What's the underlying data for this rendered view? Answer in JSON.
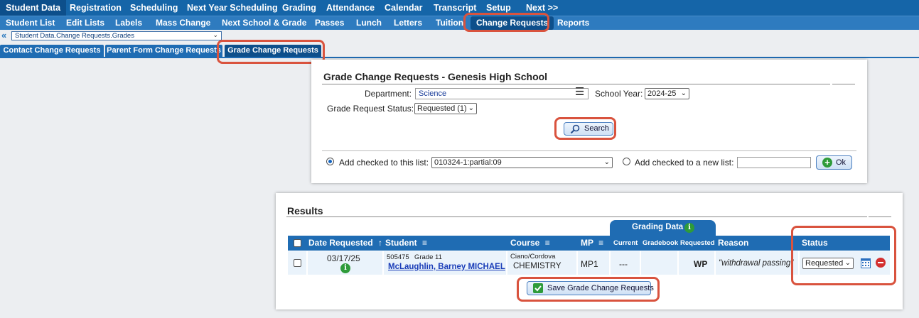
{
  "nav_main": [
    "Student Data",
    "Registration",
    "Scheduling",
    "Next Year Scheduling",
    "Grading",
    "Attendance",
    "Calendar",
    "Transcript",
    "Setup",
    "Next >>"
  ],
  "nav_sub": [
    "Student List",
    "Edit Lists",
    "Labels",
    "Mass Change",
    "Next School & Grade",
    "Passes",
    "Lunch",
    "Letters",
    "Tuition",
    "Change Requests",
    "Reports"
  ],
  "breadcrumb": "Student Data.Change Requests.Grades",
  "tabs": [
    "Contact Change Requests",
    "Parent Form Change Requests",
    "Grade Change Requests"
  ],
  "search_panel": {
    "title": "Grade Change Requests - Genesis High School",
    "department_label": "Department:",
    "department_value": "Science",
    "school_year_label": "School Year:",
    "school_year_value": "2024-25",
    "status_label": "Grade Request Status:",
    "status_value": "Requested (1)",
    "search_button": "Search",
    "add_checked_label": "Add checked to this list:",
    "list_value": "010324-1:partial:09",
    "add_new_label": "Add checked to a new list:",
    "new_list_value": "",
    "ok_button": "Ok"
  },
  "results": {
    "title": "Results",
    "grading_data_label": "Grading Data",
    "columns": {
      "date": "Date Requested",
      "student": "Student",
      "course": "Course",
      "mp": "MP",
      "current": "Current",
      "gradebook": "Gradebook",
      "requested": "Requested",
      "reason": "Reason",
      "status": "Status"
    },
    "row": {
      "date": "03/17/25",
      "student_id": "505475",
      "grade": "Grade 11",
      "student_name": "McLaughlin, Barney MICHAEL",
      "teacher": "Ciano/Cordova",
      "course": "CHEMISTRY",
      "mp": "MP1",
      "current": "---",
      "gradebook": "",
      "requested": "WP",
      "reason": "\"withdrawal passing\"",
      "status": "Requested"
    },
    "save_button": "Save Grade Change Requests"
  },
  "icons": {
    "sort_up": "↑",
    "menu": "≡",
    "info": "i",
    "search": "magnifier-icon",
    "ok": "plus-circle-icon",
    "calendar": "calendar-icon",
    "remove": "minus-circle-icon"
  },
  "colors": {
    "nav": "#1565a8",
    "subnav": "#2e7bbf",
    "header": "#1f6cb3",
    "highlight": "#d9533e",
    "info_green": "#2e9b3a",
    "remove_red": "#d32f2f"
  }
}
